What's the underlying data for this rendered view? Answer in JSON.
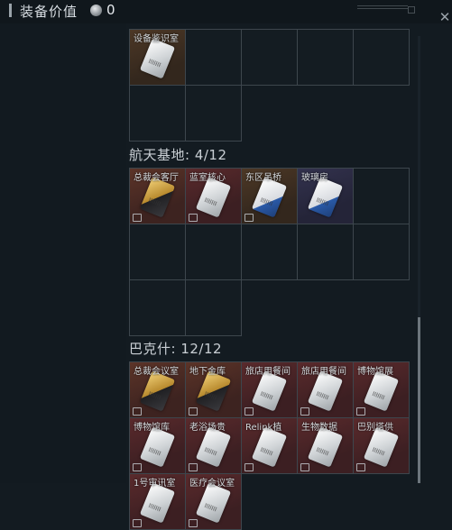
{
  "header": {
    "title": "装备价值",
    "value": "0",
    "close_glyph": "✕"
  },
  "sections": [
    {
      "heading": "",
      "items": [
        {
          "label": "设备鉴识室",
          "color": "brown",
          "card": "white",
          "badge": false
        }
      ]
    },
    {
      "heading": "航天基地: 4/12",
      "items": [
        {
          "label": "总裁会客厅",
          "color": "gold",
          "card": "gold",
          "badge": true
        },
        {
          "label": "蓝室核心",
          "color": "red",
          "card": "white",
          "badge": true
        },
        {
          "label": "东区吊桥",
          "color": "brown",
          "card": "bluec",
          "badge": true
        },
        {
          "label": "玻璃房",
          "color": "blue",
          "card": "bluec",
          "badge": false
        }
      ]
    },
    {
      "heading": "巴克什: 12/12",
      "items": [
        {
          "label": "总裁会议室",
          "color": "gold",
          "card": "gold",
          "badge": true
        },
        {
          "label": "地下金库",
          "color": "gold",
          "card": "gold",
          "badge": true
        },
        {
          "label": "旅店用餐间",
          "color": "red",
          "card": "white",
          "badge": true
        },
        {
          "label": "旅店用餐间",
          "color": "red",
          "card": "white",
          "badge": true
        },
        {
          "label": "博物馆展",
          "color": "red",
          "card": "white",
          "badge": true
        },
        {
          "label": "博物馆库",
          "color": "red",
          "card": "white",
          "badge": true
        },
        {
          "label": "老浴场贵",
          "color": "red",
          "card": "white",
          "badge": true
        },
        {
          "label": "Relink植",
          "color": "red",
          "card": "white",
          "badge": true
        },
        {
          "label": "生物数据",
          "color": "red",
          "card": "white",
          "badge": true
        },
        {
          "label": "巴别塔供",
          "color": "red",
          "card": "white",
          "badge": true
        },
        {
          "label": "1号审讯室",
          "color": "red",
          "card": "white",
          "badge": true
        },
        {
          "label": "医疗会议室",
          "color": "red",
          "card": "white",
          "badge": true
        }
      ]
    }
  ]
}
